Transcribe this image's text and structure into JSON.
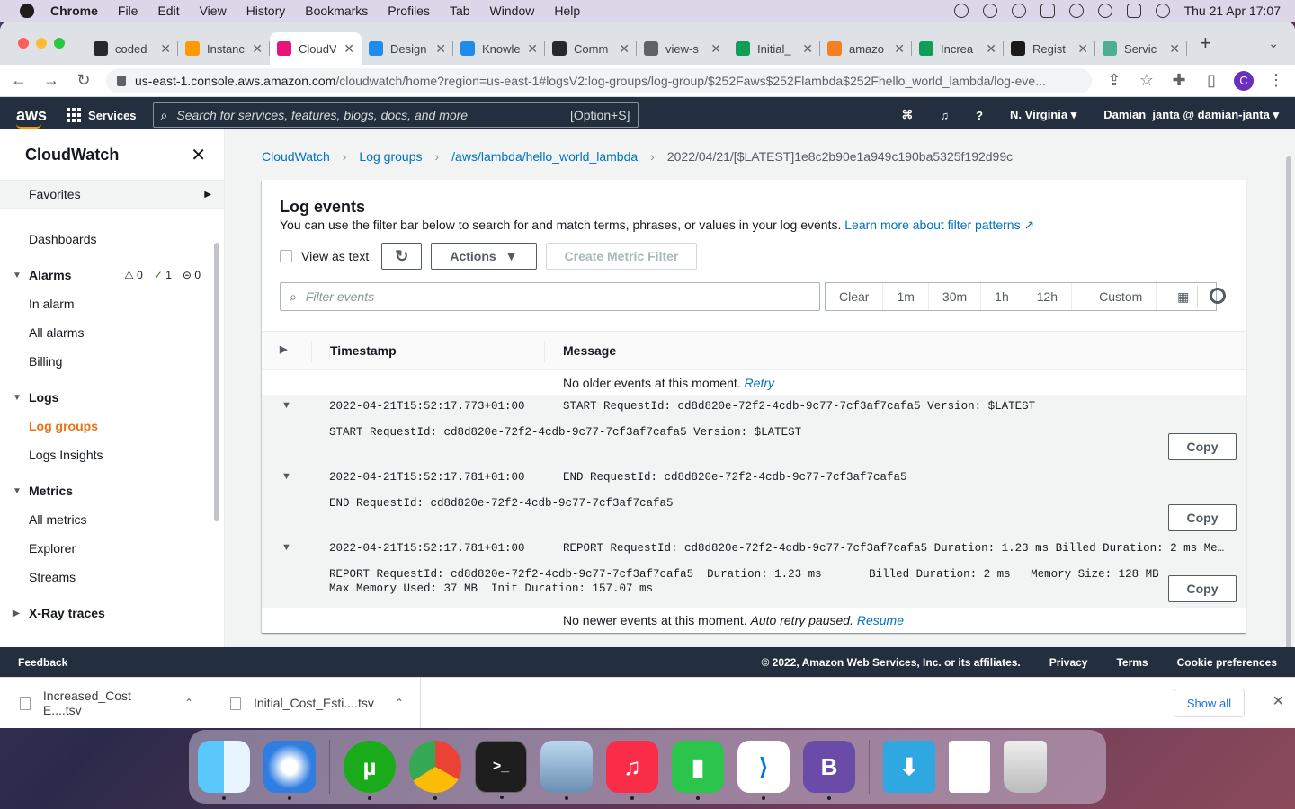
{
  "menubar": {
    "app": "Chrome",
    "items": [
      "File",
      "Edit",
      "View",
      "History",
      "Bookmarks",
      "Profiles",
      "Tab",
      "Window",
      "Help"
    ],
    "clock": "Thu 21 Apr  17:07"
  },
  "browser": {
    "tabs": [
      {
        "title": "coded",
        "color": "#24292f"
      },
      {
        "title": "Instanc",
        "color": "#ff9900"
      },
      {
        "title": "CloudV",
        "color": "#e7157b",
        "active": true
      },
      {
        "title": "Design",
        "color": "#1f8ceb"
      },
      {
        "title": "Knowle",
        "color": "#1f8ceb"
      },
      {
        "title": "Comm",
        "color": "#24292f"
      },
      {
        "title": "view-s",
        "color": "#5f6368"
      },
      {
        "title": "Initial_",
        "color": "#0f9d58"
      },
      {
        "title": "amazo",
        "color": "#f48024"
      },
      {
        "title": "Increa",
        "color": "#0f9d58"
      },
      {
        "title": "Regist",
        "color": "#1a1a1a"
      },
      {
        "title": "Servic",
        "color": "#4caf93"
      }
    ],
    "url_host": "us-east-1.console.aws.amazon.com",
    "url_path": "/cloudwatch/home?region=us-east-1#logsV2:log-groups/log-group/$252Faws$252Flambda$252Fhello_world_lambda/log-eve...",
    "profile_initial": "C"
  },
  "aws": {
    "services_label": "Services",
    "search_placeholder": "Search for services, features, blogs, docs, and more",
    "search_shortcut": "[Option+S]",
    "region": "N. Virginia",
    "account": "Damian_janta @ damian-janta"
  },
  "sidebar": {
    "title": "CloudWatch",
    "favorites": "Favorites",
    "dashboards": "Dashboards",
    "alarms": {
      "label": "Alarms",
      "warn": "0",
      "ok": "1",
      "insufficient": "0",
      "items": [
        "In alarm",
        "All alarms",
        "Billing"
      ]
    },
    "logs": {
      "label": "Logs",
      "items": [
        "Log groups",
        "Logs Insights"
      ]
    },
    "metrics": {
      "label": "Metrics",
      "items": [
        "All metrics",
        "Explorer",
        "Streams"
      ]
    },
    "xray": "X-Ray traces"
  },
  "breadcrumb": [
    "CloudWatch",
    "Log groups",
    "/aws/lambda/hello_world_lambda",
    "2022/04/21/[$LATEST]1e8c2b90e1a949c190ba5325f192d99c"
  ],
  "panel": {
    "title": "Log events",
    "description": "You can use the filter bar below to search for and match terms, phrases, or values in your log events.",
    "learn_more": "Learn more about filter patterns",
    "view_as_text": "View as text",
    "actions": "Actions",
    "create_metric_filter": "Create Metric Filter",
    "filter_placeholder": "Filter events",
    "time_options": [
      "Clear",
      "1m",
      "30m",
      "1h",
      "12h",
      "Custom"
    ],
    "col_timestamp": "Timestamp",
    "col_message": "Message",
    "older_text": "No older events at this moment.",
    "retry": "Retry",
    "newer_text": "No newer events at this moment.",
    "auto_retry": "Auto retry paused.",
    "resume": "Resume",
    "copy_label": "Copy"
  },
  "events": [
    {
      "timestamp": "2022-04-21T15:52:17.773+01:00",
      "message": "START RequestId: cd8d820e-72f2-4cdb-9c77-7cf3af7cafa5 Version: $LATEST",
      "detail": "START RequestId: cd8d820e-72f2-4cdb-9c77-7cf3af7cafa5 Version: $LATEST"
    },
    {
      "timestamp": "2022-04-21T15:52:17.781+01:00",
      "message": "END RequestId: cd8d820e-72f2-4cdb-9c77-7cf3af7cafa5",
      "detail": "END RequestId: cd8d820e-72f2-4cdb-9c77-7cf3af7cafa5"
    },
    {
      "timestamp": "2022-04-21T15:52:17.781+01:00",
      "message": "REPORT RequestId: cd8d820e-72f2-4cdb-9c77-7cf3af7cafa5 Duration: 1.23 ms Billed Duration: 2 ms Memory…",
      "detail": "REPORT RequestId: cd8d820e-72f2-4cdb-9c77-7cf3af7cafa5  Duration: 1.23 ms       Billed Duration: 2 ms   Memory Size: 128 MB\nMax Memory Used: 37 MB  Init Duration: 157.07 ms"
    }
  ],
  "footer": {
    "feedback": "Feedback",
    "copyright": "© 2022, Amazon Web Services, Inc. or its affiliates.",
    "privacy": "Privacy",
    "terms": "Terms",
    "cookies": "Cookie preferences"
  },
  "downloads": {
    "files": [
      "Increased_Cost E....tsv",
      "Initial_Cost_Esti....tsv"
    ],
    "show_all": "Show all"
  },
  "dock": [
    "Finder",
    "Safari",
    "uTorrent",
    "Chrome",
    "Terminal",
    "Preview",
    "Music",
    "Numbers",
    "VS Code",
    "BBEdit",
    "Downloads",
    "Document",
    "Trash"
  ]
}
